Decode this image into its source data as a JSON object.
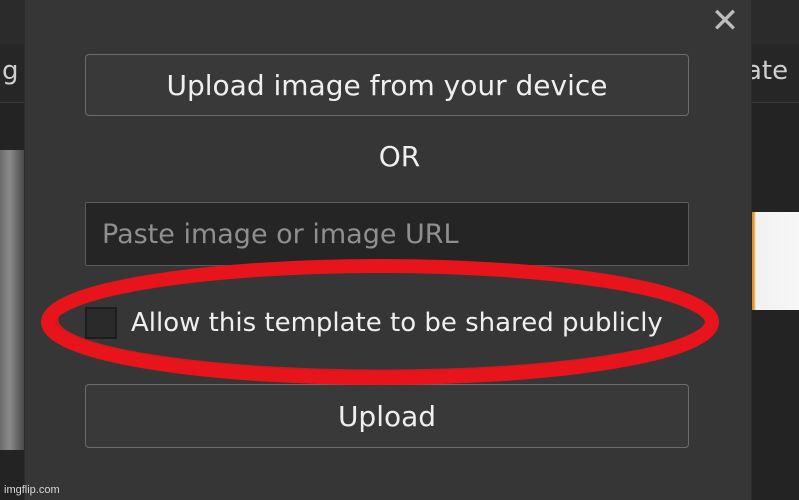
{
  "background": {
    "left_partial_text": "g",
    "right_partial_text": "ate"
  },
  "modal": {
    "close_symbol": "✕",
    "upload_device_label": "Upload image from your device",
    "or_text": "OR",
    "url_placeholder": "Paste image or image URL",
    "share_checkbox_label": "Allow this template to be shared publicly",
    "upload_label": "Upload"
  },
  "annotation": {
    "color": "#e8141b"
  },
  "watermark": "imgflip.com"
}
